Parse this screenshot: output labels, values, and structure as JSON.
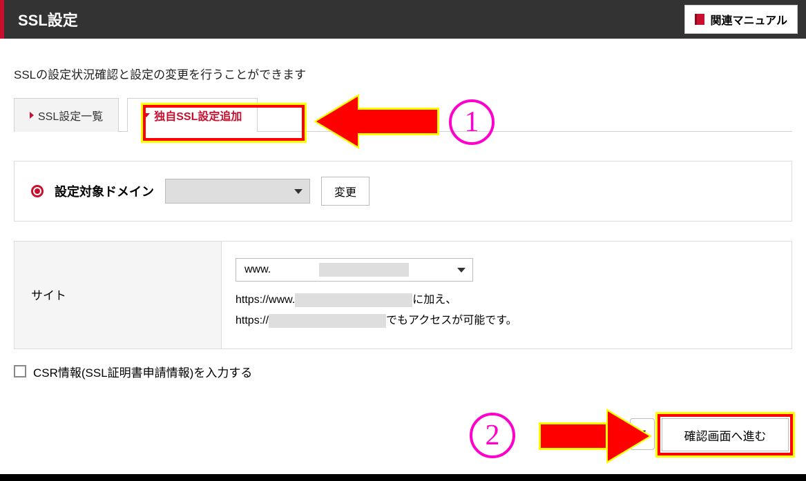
{
  "header": {
    "title": "SSL設定",
    "manual_label": "関連マニュアル"
  },
  "description": "SSLの設定状況確認と設定の変更を行うことができます",
  "tabs": {
    "list_label": "SSL設定一覧",
    "add_label": "独自SSL設定追加"
  },
  "annotations": {
    "num1": "1",
    "num2": "2"
  },
  "domain_panel": {
    "label": "設定対象ドメイン",
    "change_label": "変更"
  },
  "site": {
    "row_label": "サイト",
    "subdomain_prefix": "www.",
    "line1_prefix": "https://www.",
    "line1_suffix": "に加え、",
    "line2_prefix": "https://",
    "line2_suffix": "でもアクセスが可能です。"
  },
  "csr": {
    "label": "CSR情報(SSL証明書申請情報)を入力する"
  },
  "buttons": {
    "hidden_fragment": "る",
    "proceed_label": "確認画面へ進む"
  }
}
